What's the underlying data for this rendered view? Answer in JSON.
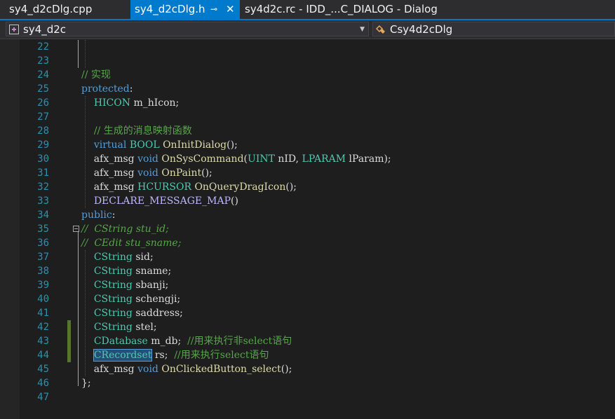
{
  "tabs": [
    {
      "label": "sy4_d2cDlg.cpp",
      "active": false
    },
    {
      "label": "sy4_d2cDlg.h",
      "active": true
    },
    {
      "label": "sy4d2c.rc - IDD_...C_DIALOG - Dialog",
      "active": false
    }
  ],
  "tab_icons": {
    "pin": "pin-icon",
    "close": "close-icon"
  },
  "navbar": {
    "project": "sy4_d2c",
    "class": "Csy4d2cDlg",
    "project_icon": "project-icon",
    "class_icon": "class-icon"
  },
  "colors": {
    "accent": "#007acc",
    "background": "#1e1e1e",
    "line_number": "#2b91af",
    "keyword": "#569cd6",
    "type": "#4ec9b0",
    "function": "#dcdcaa",
    "comment": "#57a64a",
    "macro": "#bd63c5",
    "change_marker": "#577430"
  },
  "lines": [
    {
      "n": "22",
      "parts": []
    },
    {
      "n": "23",
      "parts": []
    },
    {
      "n": "24",
      "parts": [
        {
          "s": "// 实现",
          "c": "c"
        }
      ]
    },
    {
      "n": "25",
      "parts": [
        {
          "s": "protected",
          "c": "k"
        },
        {
          "s": ":",
          "c": ""
        }
      ]
    },
    {
      "n": "26",
      "parts": [
        {
          "s": "    ",
          "c": ""
        },
        {
          "s": "HICON",
          "c": "t"
        },
        {
          "s": " m_hIcon;",
          "c": ""
        }
      ]
    },
    {
      "n": "27",
      "parts": []
    },
    {
      "n": "28",
      "parts": [
        {
          "s": "    ",
          "c": ""
        },
        {
          "s": "// 生成的消息映射函数",
          "c": "c"
        }
      ]
    },
    {
      "n": "29",
      "parts": [
        {
          "s": "    ",
          "c": ""
        },
        {
          "s": "virtual",
          "c": "k"
        },
        {
          "s": " ",
          "c": ""
        },
        {
          "s": "BOOL",
          "c": "t"
        },
        {
          "s": " ",
          "c": ""
        },
        {
          "s": "OnInitDialog",
          "c": "f"
        },
        {
          "s": "();",
          "c": ""
        }
      ]
    },
    {
      "n": "30",
      "parts": [
        {
          "s": "    afx_msg ",
          "c": ""
        },
        {
          "s": "void",
          "c": "k"
        },
        {
          "s": " ",
          "c": ""
        },
        {
          "s": "OnSysCommand",
          "c": "f"
        },
        {
          "s": "(",
          "c": ""
        },
        {
          "s": "UINT",
          "c": "t"
        },
        {
          "s": " nID, ",
          "c": ""
        },
        {
          "s": "LPARAM",
          "c": "t"
        },
        {
          "s": " lParam);",
          "c": ""
        }
      ]
    },
    {
      "n": "31",
      "parts": [
        {
          "s": "    afx_msg ",
          "c": ""
        },
        {
          "s": "void",
          "c": "k"
        },
        {
          "s": " ",
          "c": ""
        },
        {
          "s": "OnPaint",
          "c": "f"
        },
        {
          "s": "();",
          "c": ""
        }
      ]
    },
    {
      "n": "32",
      "parts": [
        {
          "s": "    afx_msg ",
          "c": ""
        },
        {
          "s": "HCURSOR",
          "c": "t"
        },
        {
          "s": " ",
          "c": ""
        },
        {
          "s": "OnQueryDragIcon",
          "c": "f"
        },
        {
          "s": "();",
          "c": ""
        }
      ]
    },
    {
      "n": "33",
      "parts": [
        {
          "s": "    ",
          "c": ""
        },
        {
          "s": "DECLARE_MESSAGE_MAP",
          "c": "mac"
        },
        {
          "s": "()",
          "c": ""
        }
      ]
    },
    {
      "n": "34",
      "parts": [
        {
          "s": "public",
          "c": "k"
        },
        {
          "s": ":",
          "c": ""
        }
      ]
    },
    {
      "n": "35",
      "parts": [
        {
          "s": "//  CString stu_id;",
          "c": "ci"
        }
      ]
    },
    {
      "n": "36",
      "parts": [
        {
          "s": "//  CEdit stu_sname;",
          "c": "ci"
        }
      ]
    },
    {
      "n": "37",
      "parts": [
        {
          "s": "    ",
          "c": ""
        },
        {
          "s": "CString",
          "c": "t"
        },
        {
          "s": " sid;",
          "c": ""
        }
      ]
    },
    {
      "n": "38",
      "parts": [
        {
          "s": "    ",
          "c": ""
        },
        {
          "s": "CString",
          "c": "t"
        },
        {
          "s": " sname;",
          "c": ""
        }
      ]
    },
    {
      "n": "39",
      "parts": [
        {
          "s": "    ",
          "c": ""
        },
        {
          "s": "CString",
          "c": "t"
        },
        {
          "s": " sbanji;",
          "c": ""
        }
      ]
    },
    {
      "n": "40",
      "parts": [
        {
          "s": "    ",
          "c": ""
        },
        {
          "s": "CString",
          "c": "t"
        },
        {
          "s": " schengji;",
          "c": ""
        }
      ]
    },
    {
      "n": "41",
      "parts": [
        {
          "s": "    ",
          "c": ""
        },
        {
          "s": "CString",
          "c": "t"
        },
        {
          "s": " saddress;",
          "c": ""
        }
      ]
    },
    {
      "n": "42",
      "parts": [
        {
          "s": "    ",
          "c": ""
        },
        {
          "s": "CString",
          "c": "t"
        },
        {
          "s": " stel;",
          "c": ""
        }
      ]
    },
    {
      "n": "43",
      "parts": [
        {
          "s": "    ",
          "c": ""
        },
        {
          "s": "CDatabase",
          "c": "t"
        },
        {
          "s": " m_db;  ",
          "c": ""
        },
        {
          "s": "//用来执行非select语句",
          "c": "c"
        }
      ]
    },
    {
      "n": "44",
      "parts": [
        {
          "s": "    ",
          "c": ""
        },
        {
          "s": "CRecordset",
          "c": "t sel"
        },
        {
          "s": " rs;  ",
          "c": ""
        },
        {
          "s": "//用来执行select语句",
          "c": "c"
        }
      ]
    },
    {
      "n": "45",
      "parts": [
        {
          "s": "    afx_msg ",
          "c": ""
        },
        {
          "s": "void",
          "c": "k"
        },
        {
          "s": " ",
          "c": ""
        },
        {
          "s": "OnClickedButton_select",
          "c": "f"
        },
        {
          "s": "();",
          "c": ""
        }
      ]
    },
    {
      "n": "46",
      "parts": [
        {
          "s": "};",
          "c": ""
        }
      ]
    },
    {
      "n": "47",
      "parts": []
    }
  ]
}
